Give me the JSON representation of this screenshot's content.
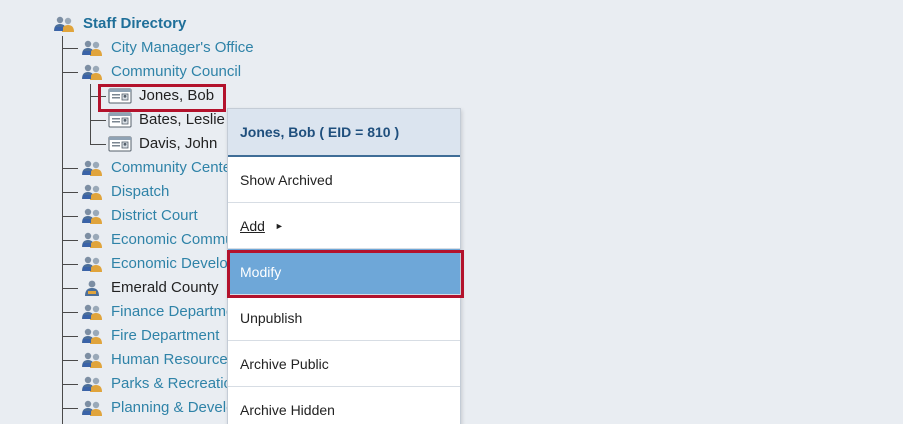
{
  "tree": {
    "root": {
      "label": "Staff Directory",
      "icon": "group-icon"
    },
    "departments": [
      {
        "label": "City Manager's Office",
        "icon": "group-icon"
      },
      {
        "label": "Community Council",
        "icon": "group-icon",
        "expanded": true,
        "people": [
          {
            "label": "Jones, Bob",
            "icon": "contact-card-icon",
            "selected": true
          },
          {
            "label": "Bates, Leslie",
            "icon": "contact-card-icon"
          },
          {
            "label": "Davis, John",
            "icon": "contact-card-icon"
          }
        ]
      },
      {
        "label": "Community Center",
        "icon": "group-icon"
      },
      {
        "label": "Dispatch",
        "icon": "group-icon"
      },
      {
        "label": "District Court",
        "icon": "group-icon"
      },
      {
        "label": "Economic Community",
        "icon": "group-icon"
      },
      {
        "label": "Economic Development",
        "icon": "group-icon"
      },
      {
        "label": "Emerald County",
        "icon": "person-icon"
      },
      {
        "label": "Finance Department",
        "icon": "group-icon"
      },
      {
        "label": "Fire Department",
        "icon": "group-icon"
      },
      {
        "label": "Human Resources",
        "icon": "group-icon"
      },
      {
        "label": "Parks & Recreation",
        "icon": "group-icon"
      },
      {
        "label": "Planning & Development",
        "icon": "group-icon"
      }
    ]
  },
  "context_menu": {
    "title": "Jones, Bob ( EID = 810 )",
    "items": [
      {
        "label": "Show Archived"
      },
      {
        "label": "Add",
        "submenu": true
      },
      {
        "label": "Modify",
        "active": true
      },
      {
        "label": "Unpublish"
      },
      {
        "label": "Archive Public"
      },
      {
        "label": "Archive Hidden"
      }
    ]
  },
  "colors": {
    "background": "#e9edf2",
    "link": "#2f83a8",
    "highlight_border": "#b3122c",
    "menu_active": "#6ea7d8"
  }
}
